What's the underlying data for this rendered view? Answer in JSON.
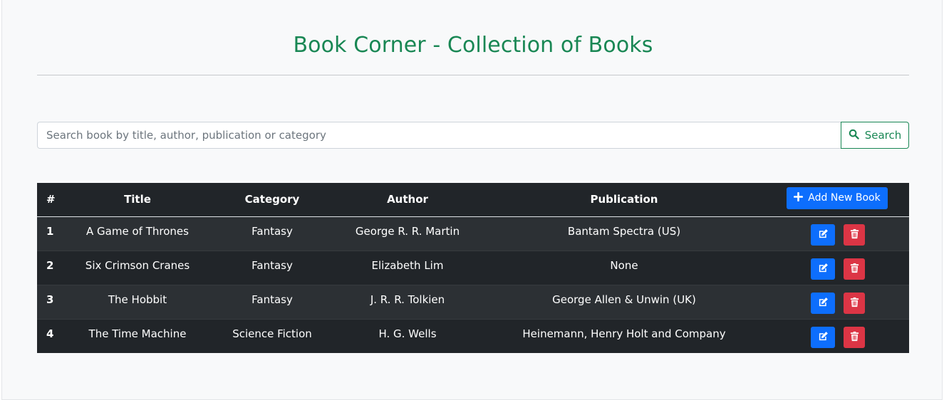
{
  "header": {
    "title": "Book Corner - Collection of Books"
  },
  "search": {
    "placeholder": "Search book by title, author, publication or category",
    "value": "",
    "button_label": "Search",
    "button_icon": "search-icon"
  },
  "table": {
    "columns": {
      "num": "#",
      "title": "Title",
      "category": "Category",
      "author": "Author",
      "publication": "Publication"
    },
    "add_button_label": "Add New Book",
    "add_button_icon": "plus-icon",
    "rows": [
      {
        "num": "1",
        "title": "A Game of Thrones",
        "category": "Fantasy",
        "author": "George R. R. Martin",
        "publication": "Bantam Spectra (US)"
      },
      {
        "num": "2",
        "title": "Six Crimson Cranes",
        "category": "Fantasy",
        "author": "Elizabeth Lim",
        "publication": "None"
      },
      {
        "num": "3",
        "title": "The Hobbit",
        "category": "Fantasy",
        "author": "J. R. R. Tolkien",
        "publication": "George Allen & Unwin (UK)"
      },
      {
        "num": "4",
        "title": "The Time Machine",
        "category": "Science Fiction",
        "author": "H. G. Wells",
        "publication": "Heinemann, Henry Holt and Company"
      }
    ],
    "row_action_icons": [
      "edit-icon",
      "trash-icon"
    ]
  },
  "colors": {
    "title_green": "#198754",
    "primary_blue": "#0d6efd",
    "danger_red": "#dc3545",
    "table_dark": "#212529",
    "table_stripe": "#2c3034",
    "page_bg": "#f8f9fa"
  }
}
